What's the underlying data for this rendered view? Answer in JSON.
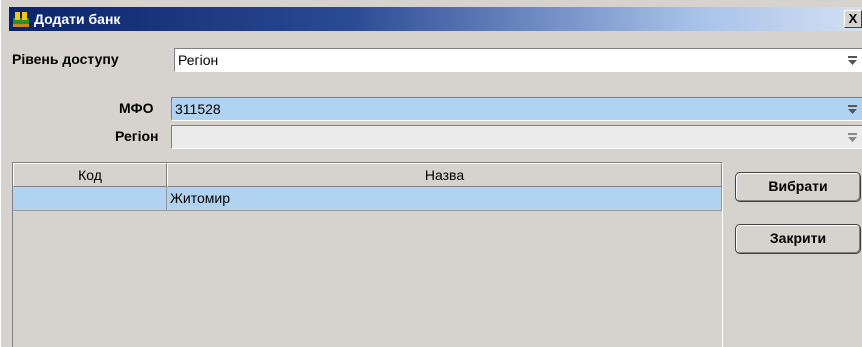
{
  "window": {
    "title": "Додати банк",
    "close_label": "X",
    "icon": "app-icon"
  },
  "form": {
    "access_level": {
      "label": "Рівень доступу",
      "value": "Регіон"
    },
    "mfo": {
      "label": "МФО",
      "value": "311528"
    },
    "region": {
      "label": "Регіон",
      "value": ""
    }
  },
  "table": {
    "columns": [
      "Код",
      "Назва"
    ],
    "rows": [
      {
        "code": "",
        "name": "Житомир"
      }
    ]
  },
  "buttons": {
    "select_label": "Вибрати",
    "close_label": "Закрити"
  },
  "colors": {
    "selection": "#b0d3f1",
    "title_start": "#0a246a",
    "title_end": "#d4dff2",
    "disabled_field": "#ebebeb"
  }
}
